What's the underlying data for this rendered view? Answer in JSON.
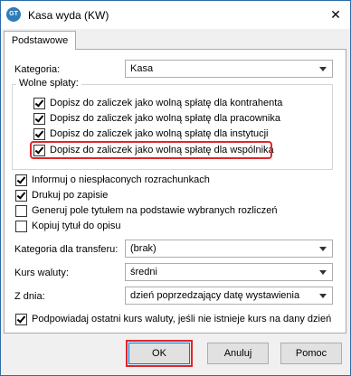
{
  "window": {
    "title": "Kasa wyda (KW)",
    "app_icon_text": "GT",
    "close_glyph": "✕"
  },
  "tabs": [
    {
      "label": "Podstawowe"
    }
  ],
  "kategoria": {
    "label": "Kategoria:",
    "value": "Kasa"
  },
  "wolne_splaty": {
    "legend": "Wolne spłaty:",
    "items": [
      {
        "label": "Dopisz do zaliczek jako wolną spłatę dla kontrahenta",
        "checked": true
      },
      {
        "label": "Dopisz do zaliczek jako wolną spłatę dla pracownika",
        "checked": true
      },
      {
        "label": "Dopisz do zaliczek jako wolną spłatę dla instytucji",
        "checked": true
      },
      {
        "label": "Dopisz do zaliczek jako wolną spłatę dla wspólnika",
        "checked": true
      }
    ]
  },
  "options": [
    {
      "label": "Informuj o niespłaconych rozrachunkach",
      "checked": true
    },
    {
      "label": "Drukuj po zapisie",
      "checked": true
    },
    {
      "label": "Generuj pole tytułem na podstawie wybranych rozliczeń",
      "checked": false
    },
    {
      "label": "Kopiuj tytuł do opisu",
      "checked": false
    }
  ],
  "kategoria_transferu": {
    "label": "Kategoria dla transferu:",
    "value": "(brak)"
  },
  "kurs_waluty": {
    "label": "Kurs waluty:",
    "value": "średni"
  },
  "z_dnia": {
    "label": "Z dnia:",
    "value": "dzień poprzedzający datę wystawienia"
  },
  "podpowiadaj": {
    "label": "Podpowiadaj ostatni kurs waluty, jeśli nie istnieje kurs na dany dzień",
    "checked": true
  },
  "buttons": {
    "ok": "OK",
    "cancel": "Anuluj",
    "help": "Pomoc"
  },
  "colors": {
    "highlight": "#e0262a",
    "window_border": "#2d6ca8",
    "focus": "#0078d7"
  }
}
